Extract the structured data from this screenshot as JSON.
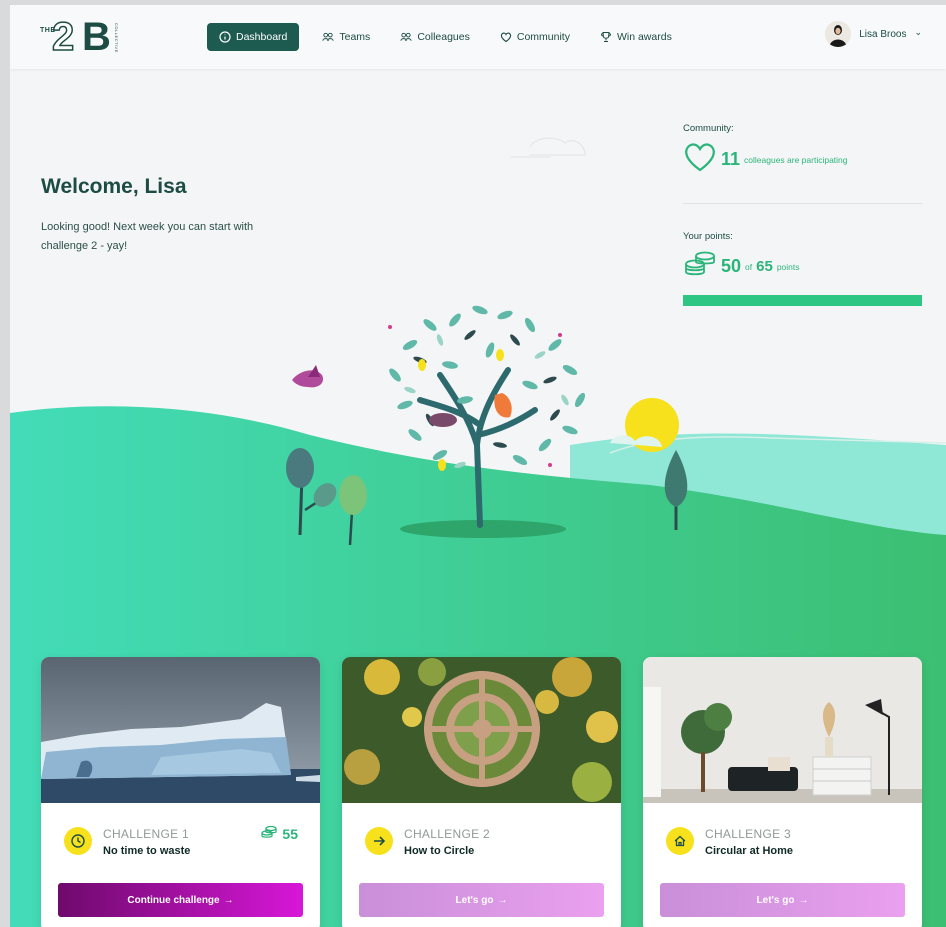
{
  "logo": {
    "the": "THE",
    "two": "2",
    "b": "B",
    "sub": "COLLECTIVE"
  },
  "nav": {
    "items": [
      {
        "label": "Dashboard",
        "icon": "info-icon",
        "active": true
      },
      {
        "label": "Teams",
        "icon": "team-icon"
      },
      {
        "label": "Colleagues",
        "icon": "colleagues-icon"
      },
      {
        "label": "Community",
        "icon": "heart-icon"
      },
      {
        "label": "Win awards",
        "icon": "trophy-icon"
      }
    ]
  },
  "user": {
    "name": "Lisa Broos",
    "chevron": "⌄"
  },
  "hero": {
    "title": "Welcome, Lisa",
    "text": "Looking good! Next week you can start with challenge 2 - yay!"
  },
  "community": {
    "label": "Community:",
    "count": "11",
    "text": "colleagues are participating"
  },
  "points": {
    "label": "Your points:",
    "current": "50",
    "of": "of",
    "total": "65",
    "unit": "points",
    "progress_fraction": 1.0
  },
  "challenges": [
    {
      "label": "CHALLENGE 1",
      "title": "No time to waste",
      "points": "55",
      "button": "Continue challenge",
      "arrow": "→",
      "icon": "clock-icon"
    },
    {
      "label": "CHALLENGE 2",
      "title": "How to Circle",
      "button": "Let's go",
      "arrow": "→",
      "icon": "arrow-right-icon"
    },
    {
      "label": "CHALLENGE 3",
      "title": "Circular at Home",
      "button": "Let's go",
      "arrow": "→",
      "icon": "home-icon"
    }
  ],
  "colors": {
    "brand_dark": "#1d5a50",
    "accent_green": "#2dc783",
    "yellow": "#f6e11c",
    "magenta_dark": "#7a0b7c",
    "magenta": "#d417d6",
    "lilac": "#d9a2e6"
  }
}
